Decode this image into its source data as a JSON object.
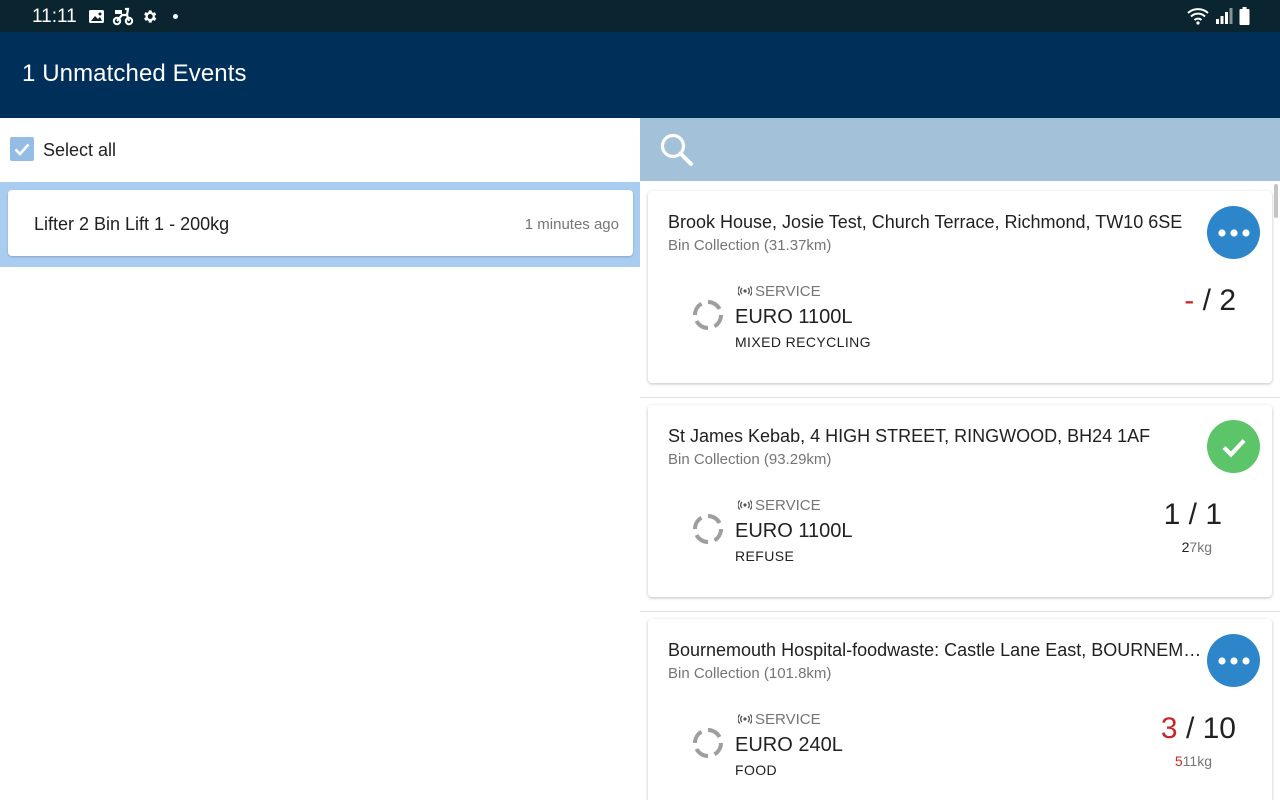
{
  "status": {
    "time": "11:11"
  },
  "appbar": {
    "title": "1 Unmatched Events"
  },
  "left": {
    "select_all_label": "Select all",
    "events": [
      {
        "name": "Lifter 2 Bin Lift 1 - 200kg",
        "time_ago": "1 minutes ago"
      }
    ]
  },
  "right": {
    "cards": [
      {
        "address": "Brook House, Josie Test, Church Terrace, Richmond, TW10 6SE",
        "subtitle": "Bin Collection (31.37km)",
        "service_label": "SERVICE",
        "bin": "EURO 1100L",
        "stream": "MIXED RECYCLING",
        "done": "-",
        "separator": " / ",
        "total": "2",
        "weight_first": "",
        "weight_rest": "",
        "action": "more"
      },
      {
        "address": "St James Kebab, 4 HIGH STREET, RINGWOOD, BH24 1AF",
        "subtitle": "Bin Collection (93.29km)",
        "service_label": "SERVICE",
        "bin": "EURO 1100L",
        "stream": "REFUSE",
        "done": "1",
        "separator": " / ",
        "total": "1",
        "weight_first": "2",
        "weight_rest": "7kg",
        "action": "done"
      },
      {
        "address": "Bournemouth Hospital-foodwaste: Castle Lane East, BOURNEMOUTH",
        "subtitle": "Bin Collection (101.8km)",
        "service_label": "SERVICE",
        "bin": "EURO 240L",
        "stream": "FOOD",
        "done": "3",
        "separator": " / ",
        "total": "10",
        "weight_first": "5",
        "weight_rest": "11kg",
        "action": "more"
      }
    ]
  },
  "colors": {
    "status_bar": "#0a2530",
    "app_bar": "#00305a",
    "selected_band": "#a8cdf0",
    "search_bar": "#a3c1d8",
    "more_button": "#2d86c9",
    "done_button": "#5cc56a",
    "incomplete_count": "#c62828"
  },
  "icons": {
    "status": [
      "image-icon",
      "scooter-icon",
      "settings-icon",
      "wifi-icon",
      "signal-icon",
      "battery-icon"
    ],
    "search": "search-icon",
    "checkbox": "check-icon",
    "card_more": "more-horizontal-icon",
    "card_done": "check-icon",
    "bin_status": "cycle-icon",
    "service": "broadcast-icon"
  }
}
